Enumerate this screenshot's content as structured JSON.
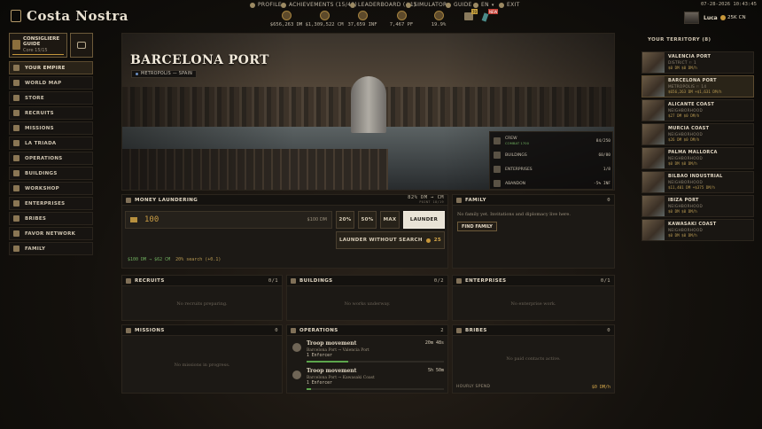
{
  "app": {
    "title": "Costa Nostra"
  },
  "topnav": [
    {
      "label": "PROFILE",
      "icon": "person-icon"
    },
    {
      "label": "ACHIEVEMENTS (15/48)",
      "icon": "trophy-icon"
    },
    {
      "label": "LEADERBOARD (#1)",
      "icon": "crown-icon"
    },
    {
      "label": "SIMULATOR",
      "icon": "swords-icon"
    },
    {
      "label": "GUIDE",
      "icon": "question-icon"
    },
    {
      "label": "EN",
      "icon": "globe-icon"
    },
    {
      "label": "EXIT",
      "icon": "exit-icon"
    }
  ],
  "datetime": "07-28-2026 10:43:45",
  "resources": [
    {
      "value": "$656,263 DM",
      "icon": "cash-icon"
    },
    {
      "value": "$1,309,522 CM",
      "icon": "money-bag-icon"
    },
    {
      "value": "37,659 INF",
      "icon": "influence-icon"
    },
    {
      "value": "7,467 PF",
      "icon": "weapon-icon"
    },
    {
      "value": "19.9%",
      "icon": "heat-icon"
    }
  ],
  "badges": {
    "mail": "70",
    "alert": "NEW"
  },
  "user": {
    "name": "Luca",
    "gold": "25K",
    "gold_label": "CN"
  },
  "consigliere": {
    "title": "CONSIGLIERE GUIDE",
    "sub": "Core 15/15"
  },
  "menu": [
    {
      "label": "YOUR EMPIRE",
      "icon": "crown-icon",
      "active": true
    },
    {
      "label": "WORLD MAP",
      "icon": "map-icon"
    },
    {
      "label": "STORE",
      "icon": "store-icon"
    },
    {
      "label": "RECRUITS",
      "icon": "recruits-icon"
    },
    {
      "label": "MISSIONS",
      "icon": "missions-icon"
    },
    {
      "label": "LA TRIADA",
      "icon": "triada-icon"
    },
    {
      "label": "OPERATIONS",
      "icon": "operations-icon"
    },
    {
      "label": "BUILDINGS",
      "icon": "buildings-icon"
    },
    {
      "label": "WORKSHOP",
      "icon": "workshop-icon"
    },
    {
      "label": "ENTERPRISES",
      "icon": "enterprises-icon"
    },
    {
      "label": "BRIBES",
      "icon": "bribes-icon"
    },
    {
      "label": "FAVOR NETWORK",
      "icon": "network-icon"
    },
    {
      "label": "FAMILY",
      "icon": "family-icon"
    }
  ],
  "hero": {
    "title": "BARCELONA PORT",
    "tag": "METROPOLIS — SPAIN",
    "stats": [
      {
        "label": "CREW",
        "sub": "COMBAT 1700",
        "value": "84/250",
        "icon": "crew-icon"
      },
      {
        "label": "BUILDINGS",
        "sub": "",
        "value": "60/80",
        "icon": "buildings-icon"
      },
      {
        "label": "ENTERPRISES",
        "sub": "",
        "value": "1/8",
        "icon": "enterprises-icon"
      },
      {
        "label": "ABANDON",
        "sub": "",
        "value": "-5% INF",
        "icon": "abandon-icon"
      }
    ]
  },
  "laundering": {
    "title": "MONEY LAUNDERING",
    "rate": "82% DM → CM",
    "rate_sub": "POINT 18/19",
    "amount": "100",
    "amount_tag": "$100 DM",
    "btn_20": "20%",
    "btn_50": "50%",
    "btn_max": "MAX",
    "btn_launder": "LAUNDER",
    "btn_nosearch": "LAUNDER WITHOUT SEARCH",
    "nosearch_cost": "25",
    "summary": "$100 DM → $62 CM",
    "summary_search": "20% search (+0.1)"
  },
  "family": {
    "title": "FAMILY",
    "count": "0",
    "text": "No family yet. Invitations and diplomacy live here.",
    "btn": "FIND FAMILY"
  },
  "recruits": {
    "title": "RECRUITS",
    "count": "0/1",
    "empty": "No recruits preparing."
  },
  "buildings": {
    "title": "BUILDINGS",
    "count": "0/2",
    "empty": "No works underway."
  },
  "enterprises": {
    "title": "ENTERPRISES",
    "count": "0/1",
    "empty": "No enterprise work."
  },
  "missions": {
    "title": "MISSIONS",
    "count": "0",
    "empty": "No missions in progress."
  },
  "operations": {
    "title": "OPERATIONS",
    "count": "2",
    "items": [
      {
        "title": "Troop movement",
        "route": "Barcelona Port → Valencia Port",
        "unit": "1 Enforcer",
        "time": "20m 48s",
        "progress": 0.3
      },
      {
        "title": "Troop movement",
        "route": "Barcelona Port → Kawasaki Coast",
        "unit": "1 Enforcer",
        "time": "5h 50m",
        "progress": 0.03
      }
    ]
  },
  "bribes": {
    "title": "BRIBES",
    "count": "0",
    "empty": "No paid contacts active.",
    "hourly_label": "HOURLY SPEND",
    "hourly_value": "$0 DM/h"
  },
  "territory": {
    "title": "YOUR TERRITORY (8)",
    "items": [
      {
        "name": "VALENCIA PORT",
        "kind": "DISTRICT ⚐ 1",
        "income": "$0 DM  $0 DM/h"
      },
      {
        "name": "BARCELONA PORT",
        "kind": "METROPOLIS ⚐ 14",
        "income": "$656,263 DM  +$1,631 DM/h",
        "selected": true
      },
      {
        "name": "ALICANTE COAST",
        "kind": "NEIGHBORHOOD",
        "income": "$27 DM  $0 DM/h"
      },
      {
        "name": "MURCIA COAST",
        "kind": "NEIGHBORHOOD",
        "income": "$26 DM  $0 DM/h"
      },
      {
        "name": "PALMA MALLORCA",
        "kind": "NEIGHBORHOOD",
        "income": "$0 DM  $0 DM/h"
      },
      {
        "name": "BILBAO INDUSTRIAL",
        "kind": "NEIGHBORHOOD",
        "income": "$11,401 DM  +$375 DM/h"
      },
      {
        "name": "IBIZA PORT",
        "kind": "NEIGHBORHOOD",
        "income": "$0 DM  $0 DM/h"
      },
      {
        "name": "KAWASAKI COAST",
        "kind": "NEIGHBORHOOD",
        "income": "$0 DM  $0 DM/h"
      }
    ]
  },
  "colors": {
    "accent": "#d7a94b",
    "progress": "#5ca54c",
    "background": "#0c0a08"
  }
}
